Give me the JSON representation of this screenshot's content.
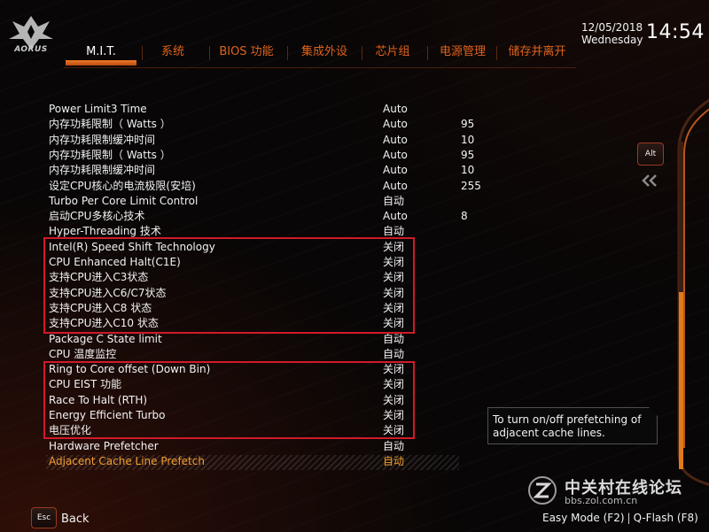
{
  "brand": {
    "logo_text": "AORUS"
  },
  "datetime": {
    "date": "12/05/2018",
    "day": "Wednesday",
    "time": "14:54"
  },
  "tabs": [
    {
      "label": "M.I.T.",
      "active": true
    },
    {
      "label": "系统"
    },
    {
      "label": "BIOS 功能"
    },
    {
      "label": "集成外设"
    },
    {
      "label": "芯片组"
    },
    {
      "label": "电源管理"
    },
    {
      "label": "储存并离开"
    }
  ],
  "settings": [
    {
      "label": "Power Limit3 Time",
      "value": "Auto",
      "num": ""
    },
    {
      "label": "内存功耗限制（ Watts ）",
      "value": "Auto",
      "num": "95"
    },
    {
      "label": "内存功耗限制缓冲时间",
      "value": "Auto",
      "num": "10"
    },
    {
      "label": "内存功耗限制（ Watts ）",
      "value": "Auto",
      "num": "95"
    },
    {
      "label": "内存功耗限制缓冲时间",
      "value": "Auto",
      "num": "10"
    },
    {
      "label": "设定CPU核心的电流极限(安培)",
      "value": "Auto",
      "num": "255"
    },
    {
      "label": "Turbo Per Core Limit Control",
      "value": "自动",
      "num": ""
    },
    {
      "label": "启动CPU多核心技术",
      "value": "Auto",
      "num": "8"
    },
    {
      "label": "Hyper-Threading 技术",
      "value": "自动",
      "num": ""
    },
    {
      "label": "Intel(R) Speed Shift Technology",
      "value": "关闭",
      "num": ""
    },
    {
      "label": "CPU Enhanced Halt(C1E)",
      "value": "关闭",
      "num": ""
    },
    {
      "label": "支持CPU进入C3状态",
      "value": "关闭",
      "num": ""
    },
    {
      "label": "支持CPU进入C6/C7状态",
      "value": "关闭",
      "num": ""
    },
    {
      "label": "支持CPU进入C8 状态",
      "value": "关闭",
      "num": ""
    },
    {
      "label": "支持CPU进入C10 状态",
      "value": "关闭",
      "num": ""
    },
    {
      "label": "Package C State limit",
      "value": "自动",
      "num": ""
    },
    {
      "label": "CPU 温度监控",
      "value": "自动",
      "num": ""
    },
    {
      "label": "Ring to Core offset (Down Bin)",
      "value": "关闭",
      "num": ""
    },
    {
      "label": "CPU EIST 功能",
      "value": "关闭",
      "num": ""
    },
    {
      "label": "Race To Halt (RTH)",
      "value": "关闭",
      "num": ""
    },
    {
      "label": "Energy Efficient Turbo",
      "value": "关闭",
      "num": ""
    },
    {
      "label": "电压优化",
      "value": "关闭",
      "num": ""
    },
    {
      "label": "Hardware Prefetcher",
      "value": "自动",
      "num": ""
    },
    {
      "label": "Adjacent Cache Line Prefetch",
      "value": "自动",
      "num": "",
      "selected": true
    }
  ],
  "side": {
    "alt_key": "Alt"
  },
  "help": {
    "text": "To turn on/off prefetching of adjacent cache lines."
  },
  "bottom": {
    "esc_key": "Esc",
    "back": "Back",
    "easy_mode": "Easy Mode (F2)",
    "qflash": "Q-Flash (F8)"
  },
  "watermark": {
    "site": "中关村在线论坛",
    "url": "bbs.zol.com.cn"
  },
  "colors": {
    "accent": "#e0621c",
    "selected_text": "#f0a030",
    "highlight_box": "#d11a2a",
    "background": "#080606"
  },
  "icons": {
    "logo": "aorus-eagle-icon",
    "chevron": "double-chevron-left-icon",
    "watermark": "zol-z-logo-icon"
  }
}
